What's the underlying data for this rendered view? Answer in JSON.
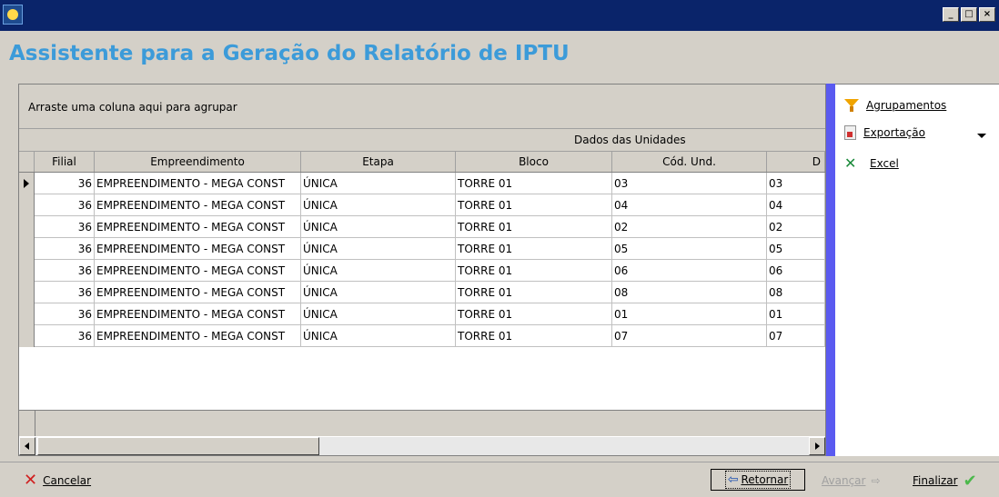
{
  "window": {
    "heading": "Assistente para a Geração do Relatório de IPTU",
    "controls": [
      "_",
      "□",
      "×"
    ]
  },
  "grid": {
    "group_hint": "Arraste uma coluna aqui para agrupar",
    "band_title": "Dados das Unidades",
    "columns": [
      "Filial",
      "Empreendimento",
      "Etapa",
      "Bloco",
      "Cód. Und.",
      "D"
    ],
    "rows": [
      [
        "36",
        "EMPREENDIMENTO - MEGA CONST",
        "ÚNICA",
        "TORRE 01",
        "03",
        "03"
      ],
      [
        "36",
        "EMPREENDIMENTO - MEGA CONST",
        "ÚNICA",
        "TORRE 01",
        "04",
        "04"
      ],
      [
        "36",
        "EMPREENDIMENTO - MEGA CONST",
        "ÚNICA",
        "TORRE 01",
        "02",
        "02"
      ],
      [
        "36",
        "EMPREENDIMENTO - MEGA CONST",
        "ÚNICA",
        "TORRE 01",
        "05",
        "05"
      ],
      [
        "36",
        "EMPREENDIMENTO - MEGA CONST",
        "ÚNICA",
        "TORRE 01",
        "06",
        "06"
      ],
      [
        "36",
        "EMPREENDIMENTO - MEGA CONST",
        "ÚNICA",
        "TORRE 01",
        "08",
        "08"
      ],
      [
        "36",
        "EMPREENDIMENTO - MEGA CONST",
        "ÚNICA",
        "TORRE 01",
        "01",
        "01"
      ],
      [
        "36",
        "EMPREENDIMENTO - MEGA CONST",
        "ÚNICA",
        "TORRE 01",
        "07",
        "07"
      ]
    ]
  },
  "side": {
    "agrupamentos": "Agrupamentos",
    "exportacao": "Exportação",
    "excel": "Excel"
  },
  "footer": {
    "cancelar": "Cancelar",
    "retornar": "Retornar",
    "avancar": "Avançar",
    "finalizar": "Finalizar"
  }
}
